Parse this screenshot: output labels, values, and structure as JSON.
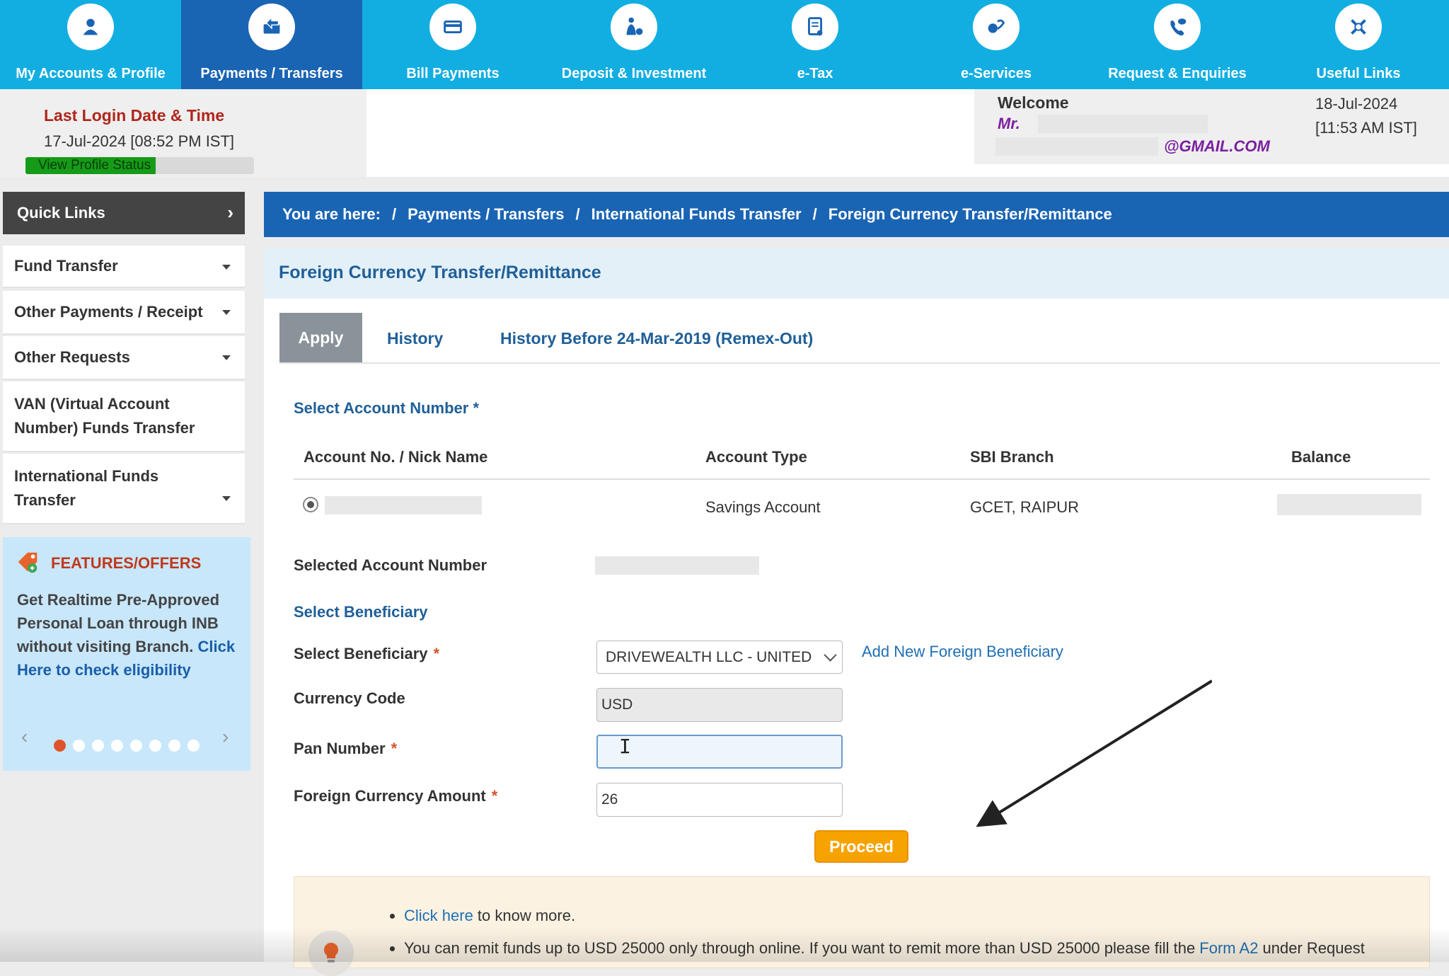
{
  "nav": {
    "items": [
      {
        "label": "My Accounts & Profile",
        "icon": "user-icon"
      },
      {
        "label": "Payments / Transfers",
        "icon": "transfer-icon",
        "active": true
      },
      {
        "label": "Bill Payments",
        "icon": "card-icon"
      },
      {
        "label": "Deposit & Investment",
        "icon": "money-bag-icon"
      },
      {
        "label": "e-Tax",
        "icon": "tax-document-icon"
      },
      {
        "label": "e-Services",
        "icon": "services-icon"
      },
      {
        "label": "Request & Enquiries",
        "icon": "phone-chat-icon"
      },
      {
        "label": "Useful Links",
        "icon": "tools-icon"
      }
    ]
  },
  "header": {
    "last_login_title": "Last Login Date & Time",
    "last_login_value": "17-Jul-2024 [08:52 PM IST]",
    "profile_status_label": "View Profile Status",
    "profile_status_fraction": 0.57,
    "welcome_title": "Welcome",
    "welcome_salutation": "Mr.",
    "welcome_email": "@GMAIL.COM",
    "current_date": "18-Jul-2024",
    "current_time": "[11:53 AM IST]"
  },
  "sidebar": {
    "quick_links_label": "Quick Links",
    "items": [
      {
        "label": "Fund Transfer"
      },
      {
        "label": "Other Payments / Receipt"
      },
      {
        "label": "Other Requests"
      },
      {
        "line1": "VAN (Virtual Account",
        "line2": "Number) Funds Transfer"
      },
      {
        "line1": "International Funds",
        "line2": "Transfer"
      }
    ],
    "offers": {
      "title": "FEATURES/OFFERS",
      "text": "Get Realtime Pre-Approved Personal Loan through INB without visiting Branch.",
      "link": "Click Here to check eligibility",
      "dots_count": 8,
      "active_dot": 0
    }
  },
  "breadcrumb": {
    "prefix": "You are here:",
    "items": [
      "Payments / Transfers",
      "International Funds Transfer",
      "Foreign Currency Transfer/Remittance"
    ]
  },
  "main": {
    "title": "Foreign Currency Transfer/Remittance",
    "tabs": [
      "Apply",
      "History",
      "History Before 24-Mar-2019 (Remex-Out)"
    ],
    "select_account_title": "Select Account Number *",
    "table": {
      "headers": [
        "Account No. / Nick Name",
        "Account Type",
        "SBI Branch",
        "Balance"
      ],
      "row": {
        "account_type": "Savings Account",
        "branch": "GCET, RAIPUR"
      }
    },
    "selected_account_label": "Selected Account Number",
    "select_beneficiary_title": "Select Beneficiary",
    "form": {
      "beneficiary_label": "Select Beneficiary",
      "beneficiary_value": "DRIVEWEALTH LLC - UNITED",
      "add_beneficiary_link": "Add New Foreign Beneficiary",
      "currency_label": "Currency Code",
      "currency_value": "USD",
      "pan_label": "Pan Number",
      "pan_value": "",
      "amount_label": "Foreign Currency Amount",
      "amount_value": "26",
      "required_mark": "*",
      "proceed_label": "Proceed"
    },
    "info": {
      "line1_link": "Click here",
      "line1_text": " to know more.",
      "line2_text": "You can remit funds up to USD 25000 only through online. If you want to remit more than USD 25000 please fill the ",
      "line2_link": "Form A2",
      "line2_tail": " under Request"
    }
  },
  "colors": {
    "nav_bg": "#12aee2",
    "nav_active": "#1a64b4",
    "breadcrumb_bg": "#1a64b4",
    "link_blue": "#1f5f98",
    "proceed_orange": "#f6a300",
    "alert_red": "#b0261c"
  }
}
